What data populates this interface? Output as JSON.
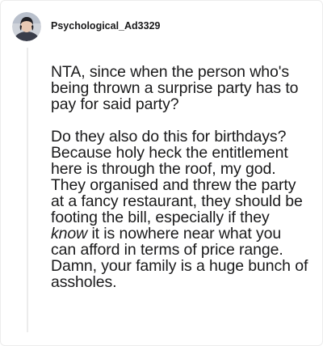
{
  "comment": {
    "username": "Psychological_Ad3329",
    "paragraph_1": "NTA, since when the person who's being thrown a surprise party has to pay for said party?",
    "paragraph_2_before": "Do they also do this for birthdays? Because holy heck the entitlement here is through the roof, my god. They organised and threw the party at a fancy restaurant, they should be footing the bill, especially if they ",
    "paragraph_2_emphasis": "know",
    "paragraph_2_after": " it is nowhere near what you can afford in terms of price range. Damn, your family is a huge bunch of assholes."
  }
}
